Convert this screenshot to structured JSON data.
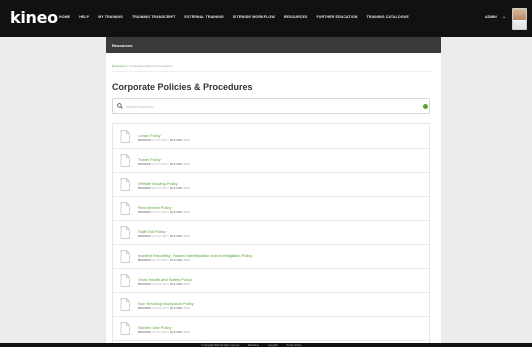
{
  "nav": {
    "logo": "kineo",
    "items": [
      "HOME",
      "HELP",
      "MY TRAINING",
      "TRAINING TRANSCRIPT",
      "EXTERNAL TRAINING",
      "SITEWIDE WORKFLOW",
      "RESOURCES",
      "FURTHER EDUCATION",
      "TRAINING CATALOGUE"
    ],
    "user": "ADMIN",
    "caret": "⌄"
  },
  "panel": {
    "header": "Resources",
    "breadcrumb_home": "Resources",
    "breadcrumb_sep": " / ",
    "breadcrumb_current": "Corporate Policies & Procedures",
    "title": "Corporate Policies & Procedures"
  },
  "search": {
    "placeholder": "Search Resources..."
  },
  "items": [
    {
      "title": "Leave Policy",
      "modified_label": "MODIFIED:",
      "modified": "20 OCT 2017",
      "size_label": "FILE SIZE:",
      "size": "85KB"
    },
    {
      "title": "Travel Policy",
      "modified_label": "MODIFIED:",
      "modified": "20 OCT 2017",
      "size_label": "FILE SIZE:",
      "size": "85KB"
    },
    {
      "title": "Whistle blowing Policy",
      "modified_label": "MODIFIED:",
      "modified": "20 OCT 2017",
      "size_label": "FILE SIZE:",
      "size": "85KB"
    },
    {
      "title": "Recruitment Policy",
      "modified_label": "MODIFIED:",
      "modified": "20 OCT 2017",
      "size_label": "FILE SIZE:",
      "size": "85KB"
    },
    {
      "title": "Staff Exit Policy",
      "modified_label": "MODIFIED:",
      "modified": "20 OCT 2017",
      "size_label": "FILE SIZE:",
      "size": "85KB"
    },
    {
      "title": "Incident Reporting, Hazard Identification and Investigation Policy",
      "modified_label": "MODIFIED:",
      "modified": "20 OCT 2017",
      "size_label": "FILE SIZE:",
      "size": "85KB"
    },
    {
      "title": "Work Health and Safety Policy",
      "modified_label": "MODIFIED:",
      "modified": "20 OCT 2017",
      "size_label": "FILE SIZE:",
      "size": "85KB"
    },
    {
      "title": "Non Smoking Workplace Policy",
      "modified_label": "MODIFIED:",
      "modified": "20 OCT 2017",
      "size_label": "FILE SIZE:",
      "size": "85KB"
    },
    {
      "title": "Kitchen Use Policy",
      "modified_label": "MODIFIED:",
      "modified": "20 OCT 2017",
      "size_label": "FILE SIZE:",
      "size": "85KB"
    }
  ],
  "footer": {
    "copyright": "© Copyright 2018 all rights reserved",
    "links": [
      "Disclaimer",
      "Copyright",
      "Privacy Policy"
    ]
  },
  "colors": {
    "accent": "#5aa031",
    "nav_bg": "#111111",
    "panel_header_bg": "#3a3a3a"
  },
  "icons": {
    "search": "search-icon",
    "document": "document-icon",
    "status": "status-dot-icon"
  }
}
